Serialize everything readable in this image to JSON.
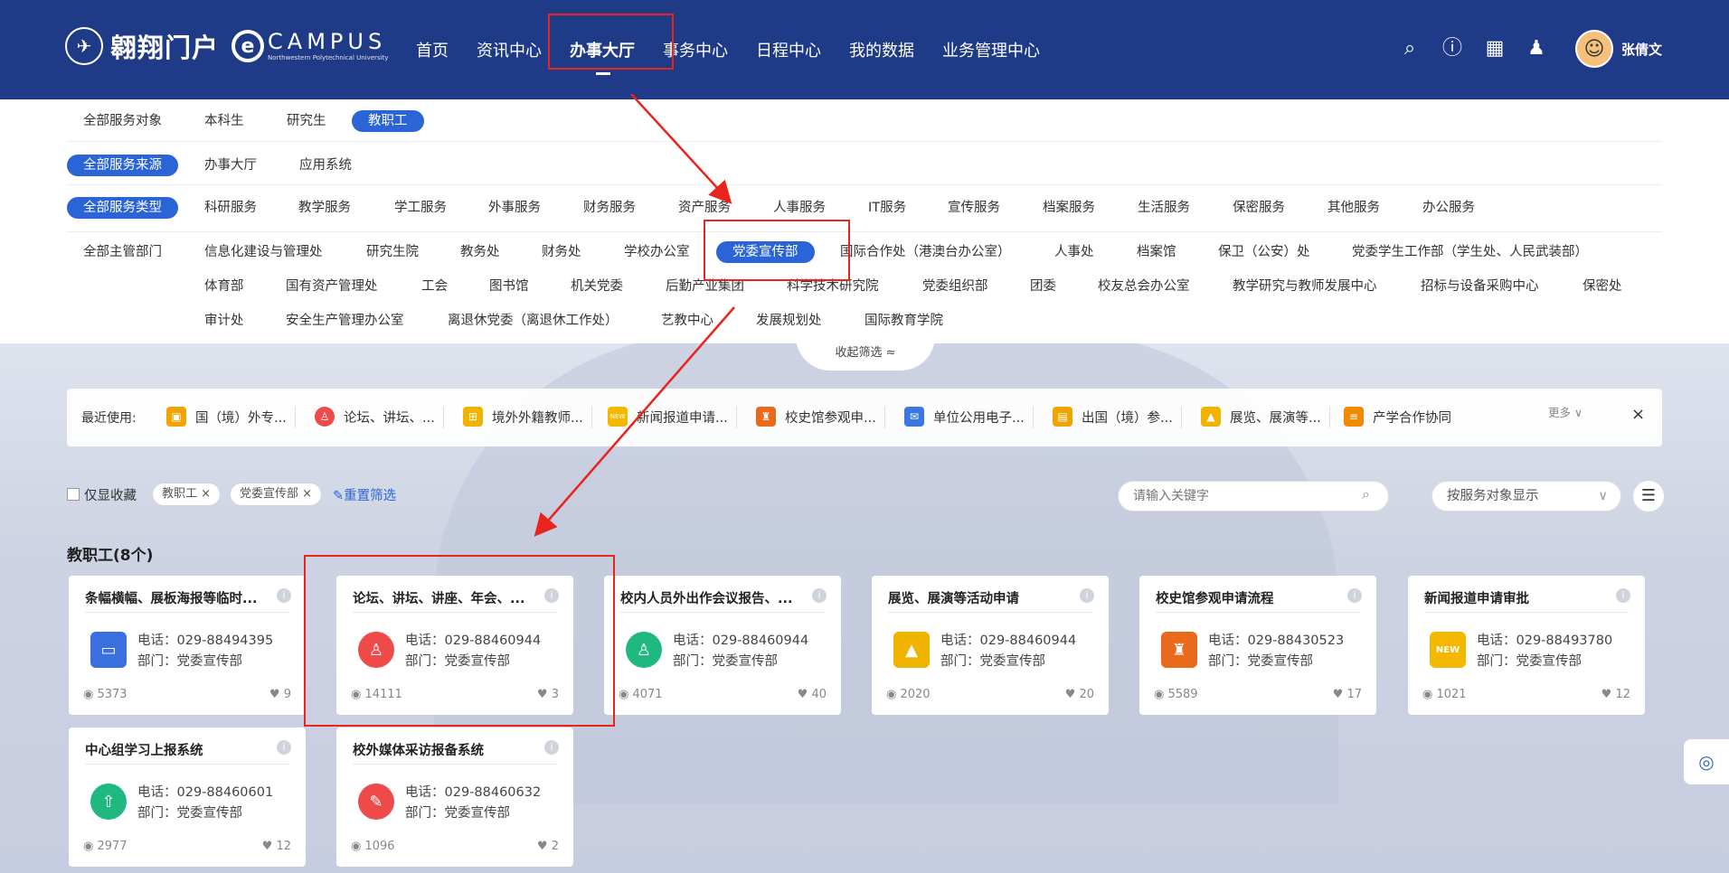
{
  "header": {
    "logo_name": "翱翔门户",
    "logo_campus": "CAMPUS",
    "logo_campus_sub": "Northwestern Polytechnical University",
    "nav": [
      "首页",
      "资讯中心",
      "办事大厅",
      "事务中心",
      "日程中心",
      "我的数据",
      "业务管理中心"
    ],
    "active_nav": "办事大厅",
    "icons": [
      "search-icon",
      "help-icon",
      "qrcode-icon",
      "skin-icon"
    ],
    "user_name": "张倩文"
  },
  "filters": {
    "audience": [
      "全部服务对象",
      "本科生",
      "研究生",
      "教职工"
    ],
    "audience_selected": "教职工",
    "source": [
      "全部服务来源",
      "办事大厅",
      "应用系统"
    ],
    "source_selected": "全部服务来源",
    "types": [
      "全部服务类型",
      "科研服务",
      "教学服务",
      "学工服务",
      "外事服务",
      "财务服务",
      "资产服务",
      "人事服务",
      "IT服务",
      "宣传服务",
      "档案服务",
      "生活服务",
      "保密服务",
      "其他服务",
      "办公服务"
    ],
    "types_selected": "全部服务类型",
    "departments_row1": [
      "全部主管部门",
      "信息化建设与管理处",
      "研究生院",
      "教务处",
      "财务处",
      "学校办公室",
      "党委宣传部",
      "国际合作处（港澳台办公室）",
      "人事处",
      "档案馆",
      "保卫（公安）处",
      "党委学生工作部（学生处、人民武装部）"
    ],
    "departments_row2": [
      "体育部",
      "国有资产管理处",
      "工会",
      "图书馆",
      "机关党委",
      "后勤产业集团",
      "科学技术研究院",
      "党委组织部",
      "团委",
      "校友总会办公室",
      "教学研究与教师发展中心",
      "招标与设备采购中心",
      "保密处"
    ],
    "departments_row3": [
      "审计处",
      "安全生产管理办公室",
      "离退休党委（离退休工作处）",
      "艺教中心",
      "发展规划处",
      "国际教育学院"
    ],
    "department_selected": "党委宣传部",
    "collapse_label": "收起筛选 ≈"
  },
  "recent": {
    "label": "最近使用:",
    "items": [
      {
        "label": "国（境）外专...",
        "color": "#f0a400"
      },
      {
        "label": "论坛、讲坛、...",
        "color": "#ef4a4a"
      },
      {
        "label": "境外外籍教师...",
        "color": "#f0b400"
      },
      {
        "label": "新闻报道申请...",
        "color": "#f5b800"
      },
      {
        "label": "校史馆参观申...",
        "color": "#e86a1a"
      },
      {
        "label": "单位公用电子...",
        "color": "#3a78e0"
      },
      {
        "label": "出国（境）参...",
        "color": "#f0a400"
      },
      {
        "label": "展览、展演等...",
        "color": "#f0b400"
      },
      {
        "label": "产学合作协同",
        "color": "#f08a00"
      }
    ],
    "more": "更多 ∨",
    "close": "×"
  },
  "toolbar": {
    "favorites_only": "仅显收藏",
    "tags": [
      "教职工 ×",
      "党委宣传部 ×"
    ],
    "reset": "重置筛选",
    "search_placeholder": "请输入关键字",
    "display_mode": "按服务对象显示",
    "list_icon": "list-icon"
  },
  "section_title": "教职工(8个)",
  "cards": [
    {
      "title": "条幅横幅、展板海报等临时...",
      "phone": "电话：029-88494395",
      "dept": "部门：党委宣传部",
      "views": "5373",
      "likes": "9",
      "color": "#3a6fe0",
      "icon": "banner-icon"
    },
    {
      "title": "论坛、讲坛、讲座、年会、...",
      "phone": "电话：029-88460944",
      "dept": "部门：党委宣传部",
      "views": "14111",
      "likes": "3",
      "color": "#ef4a4a",
      "icon": "podium-icon"
    },
    {
      "title": "校内人员外出作会议报告、...",
      "phone": "电话：029-88460944",
      "dept": "部门：党委宣传部",
      "views": "4071",
      "likes": "40",
      "color": "#1fb980",
      "icon": "report-icon"
    },
    {
      "title": "展览、展演等活动申请",
      "phone": "电话：029-88460944",
      "dept": "部门：党委宣传部",
      "views": "2020",
      "likes": "20",
      "color": "#f0b400",
      "icon": "exhibition-icon"
    },
    {
      "title": "校史馆参观申请流程",
      "phone": "电话：029-88430523",
      "dept": "部门：党委宣传部",
      "views": "5589",
      "likes": "17",
      "color": "#e86a1a",
      "icon": "museum-icon"
    },
    {
      "title": "新闻报道申请审批",
      "phone": "电话：029-88493780",
      "dept": "部门：党委宣传部",
      "views": "1021",
      "likes": "12",
      "color": "#f5b800",
      "icon": "new-icon"
    },
    {
      "title": "中心组学习上报系统",
      "phone": "电话：029-88460601",
      "dept": "部门：党委宣传部",
      "views": "2977",
      "likes": "12",
      "color": "#1fb980",
      "icon": "upload-icon"
    },
    {
      "title": "校外媒体采访报备系统",
      "phone": "电话：029-88460632",
      "dept": "部门：党委宣传部",
      "views": "1096",
      "likes": "2",
      "color": "#ef4a4a",
      "icon": "interview-icon"
    }
  ]
}
